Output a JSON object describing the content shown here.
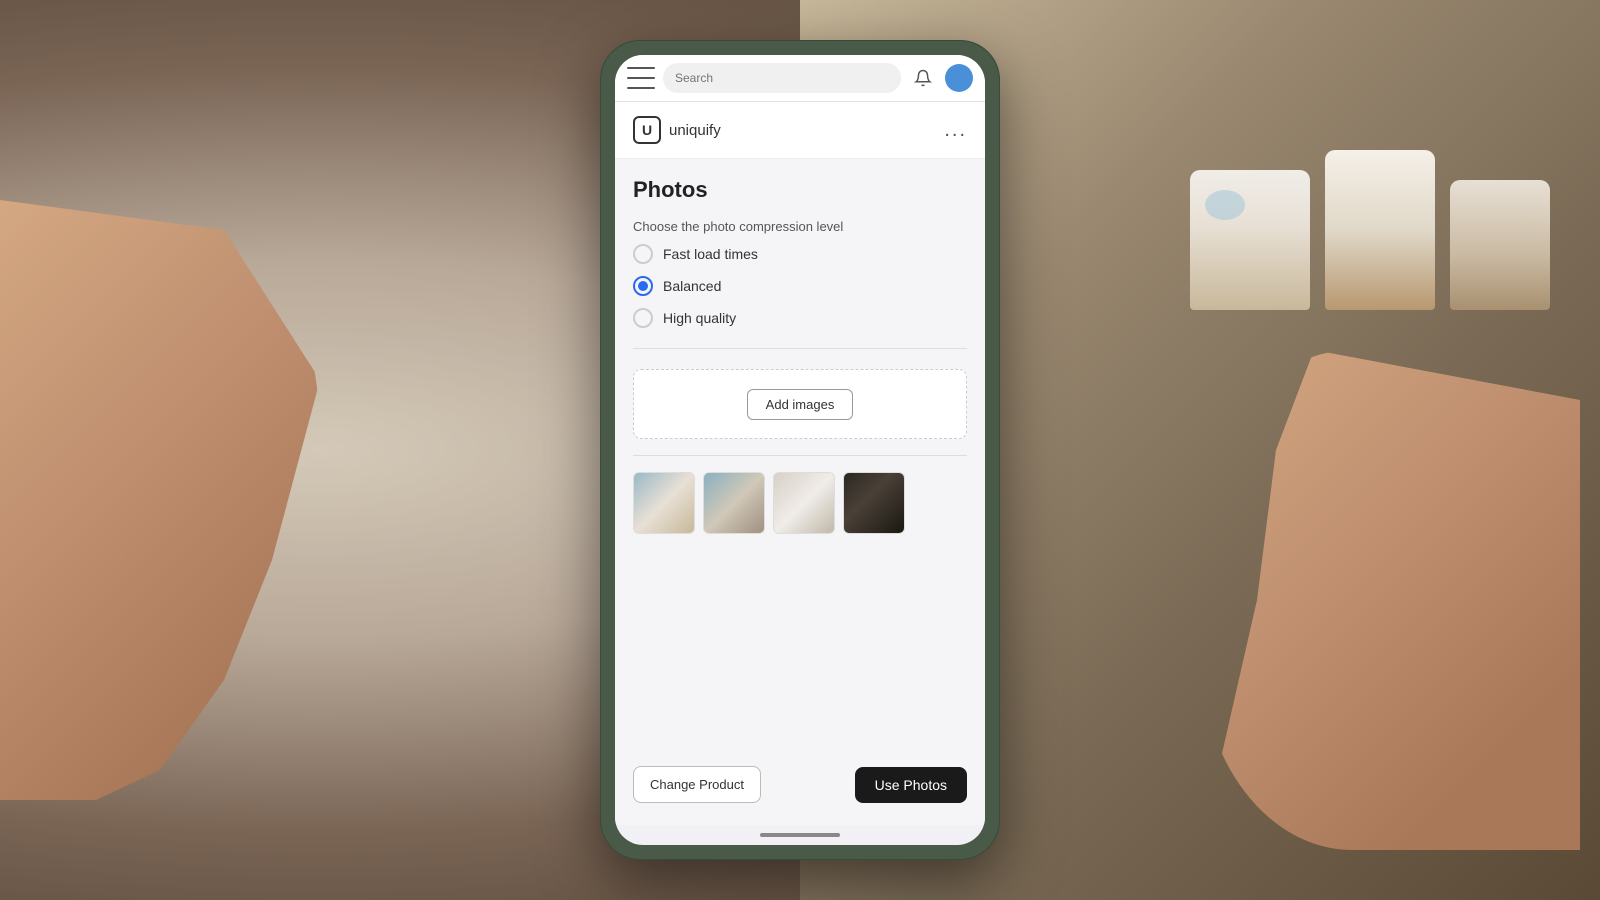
{
  "background": {
    "description": "Hands holding phone with soap products in background"
  },
  "topBar": {
    "searchPlaceholder": "Search",
    "menuLabel": "menu",
    "bellLabel": "notifications",
    "avatarLabel": "user avatar"
  },
  "appHeader": {
    "logoText": "U",
    "appName": "uniquify",
    "moreLabel": "..."
  },
  "page": {
    "title": "Photos",
    "compressionLabel": "Choose the photo compression level",
    "radioOptions": [
      {
        "id": "fast",
        "label": "Fast load times",
        "selected": false
      },
      {
        "id": "balanced",
        "label": "Balanced",
        "selected": true
      },
      {
        "id": "highquality",
        "label": "High quality",
        "selected": false
      }
    ],
    "addImagesLabel": "Add images",
    "thumbnails": [
      {
        "id": 1,
        "alt": "Soap photo 1"
      },
      {
        "id": 2,
        "alt": "Soap photo 2"
      },
      {
        "id": 3,
        "alt": "Soap photo 3"
      },
      {
        "id": 4,
        "alt": "Soap photo 4"
      }
    ],
    "changeProductLabel": "Change Product",
    "usePhotosLabel": "Use Photos"
  }
}
